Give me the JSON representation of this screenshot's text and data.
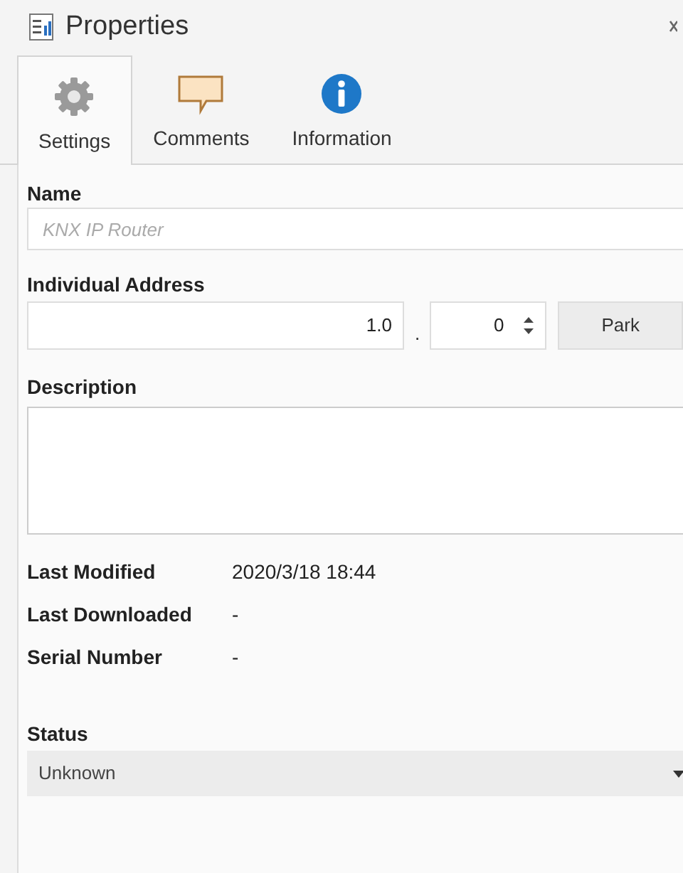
{
  "window": {
    "title": "Properties"
  },
  "tabs": [
    {
      "label": "Settings",
      "kind": "gear",
      "selected": true
    },
    {
      "label": "Comments",
      "kind": "comment",
      "selected": false
    },
    {
      "label": "Information",
      "kind": "info",
      "selected": false
    }
  ],
  "name": {
    "label": "Name",
    "placeholder": "KNX IP Router"
  },
  "address": {
    "label": "Individual Address",
    "value": "1.0",
    "separator": ".",
    "device": "0",
    "park_button": "Park"
  },
  "description": {
    "label": "Description"
  },
  "info": [
    {
      "label": "Last Modified",
      "value": "2020/3/18 18:44"
    },
    {
      "label": "Last Downloaded",
      "value": "-"
    },
    {
      "label": "Serial Number",
      "value": "-"
    }
  ],
  "status": {
    "label": "Status",
    "value": "Unknown"
  }
}
